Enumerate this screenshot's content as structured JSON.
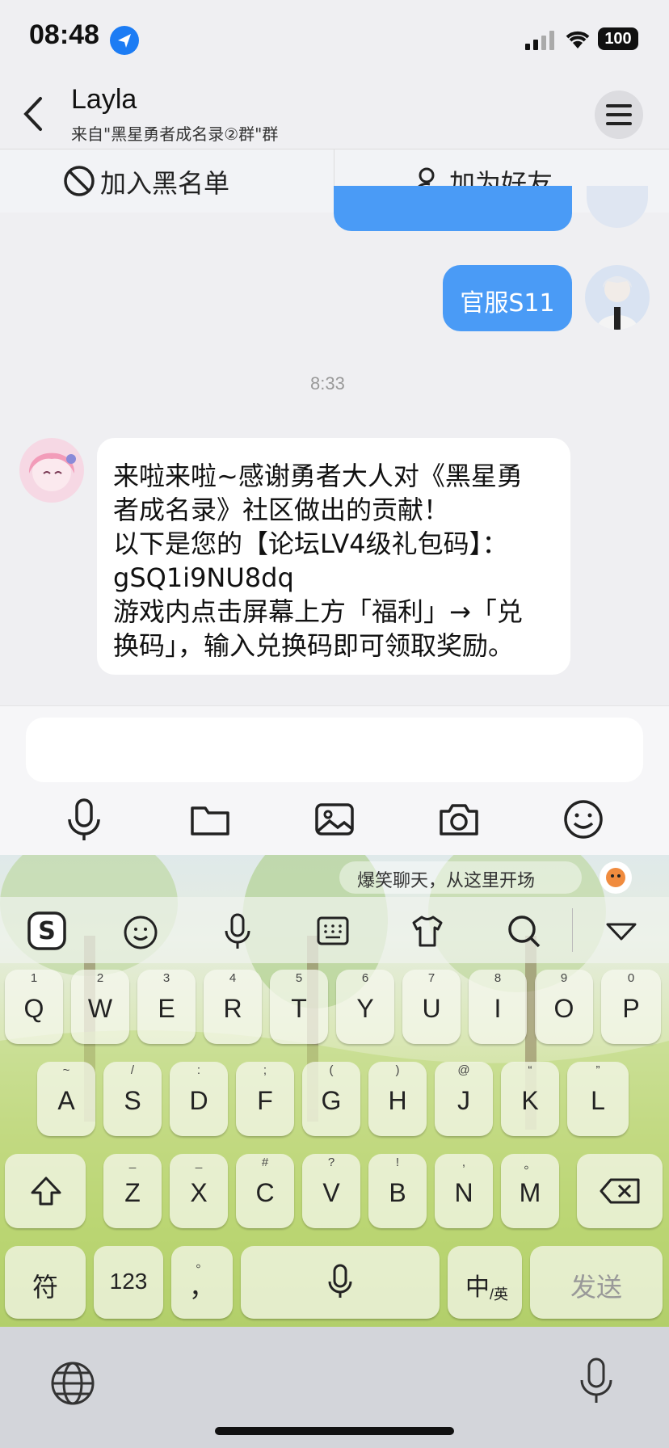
{
  "status": {
    "time": "08:48",
    "battery": "100"
  },
  "header": {
    "title": "Layla",
    "subtitle": "来自\"黑星勇者成名录②群\"群"
  },
  "actions": {
    "block": "加入黑名单",
    "add_friend": "加为好友"
  },
  "chat": {
    "my_message": "官服S11",
    "timestamp": "8:33",
    "their_message_lines": [
      "来啦来啦~感谢勇者大人对《黑星勇",
      "者成名录》社区做出的贡献！",
      "以下是您的【论坛LV4级礼包码】：",
      "gSQ1i9NU8dq",
      "游戏内点击屏幕上方「福利」→「兑",
      "换码」，输入兑换码即可领取奖励。"
    ]
  },
  "keyboard": {
    "banner": "爆笑聊天，从这里开场",
    "row1": [
      {
        "k": "Q",
        "s": "1"
      },
      {
        "k": "W",
        "s": "2"
      },
      {
        "k": "E",
        "s": "3"
      },
      {
        "k": "R",
        "s": "4"
      },
      {
        "k": "T",
        "s": "5"
      },
      {
        "k": "Y",
        "s": "6"
      },
      {
        "k": "U",
        "s": "7"
      },
      {
        "k": "I",
        "s": "8"
      },
      {
        "k": "O",
        "s": "9"
      },
      {
        "k": "P",
        "s": "0"
      }
    ],
    "row2": [
      {
        "k": "A",
        "s": "~"
      },
      {
        "k": "S",
        "s": "/"
      },
      {
        "k": "D",
        "s": ":"
      },
      {
        "k": "F",
        "s": ";"
      },
      {
        "k": "G",
        "s": "("
      },
      {
        "k": "H",
        "s": ")"
      },
      {
        "k": "J",
        "s": "@"
      },
      {
        "k": "K",
        "s": "“"
      },
      {
        "k": "L",
        "s": "”"
      }
    ],
    "row3": [
      {
        "k": "Z",
        "s": "_"
      },
      {
        "k": "X",
        "s": "_"
      },
      {
        "k": "C",
        "s": "#"
      },
      {
        "k": "V",
        "s": "?"
      },
      {
        "k": "B",
        "s": "!"
      },
      {
        "k": "N",
        "s": ","
      },
      {
        "k": "M",
        "s": "。"
      }
    ],
    "fu": "符",
    "num": "123",
    "comma": "，",
    "comma_sup": "。",
    "zh": "中",
    "zh_sub": "/英",
    "send": "发送"
  }
}
